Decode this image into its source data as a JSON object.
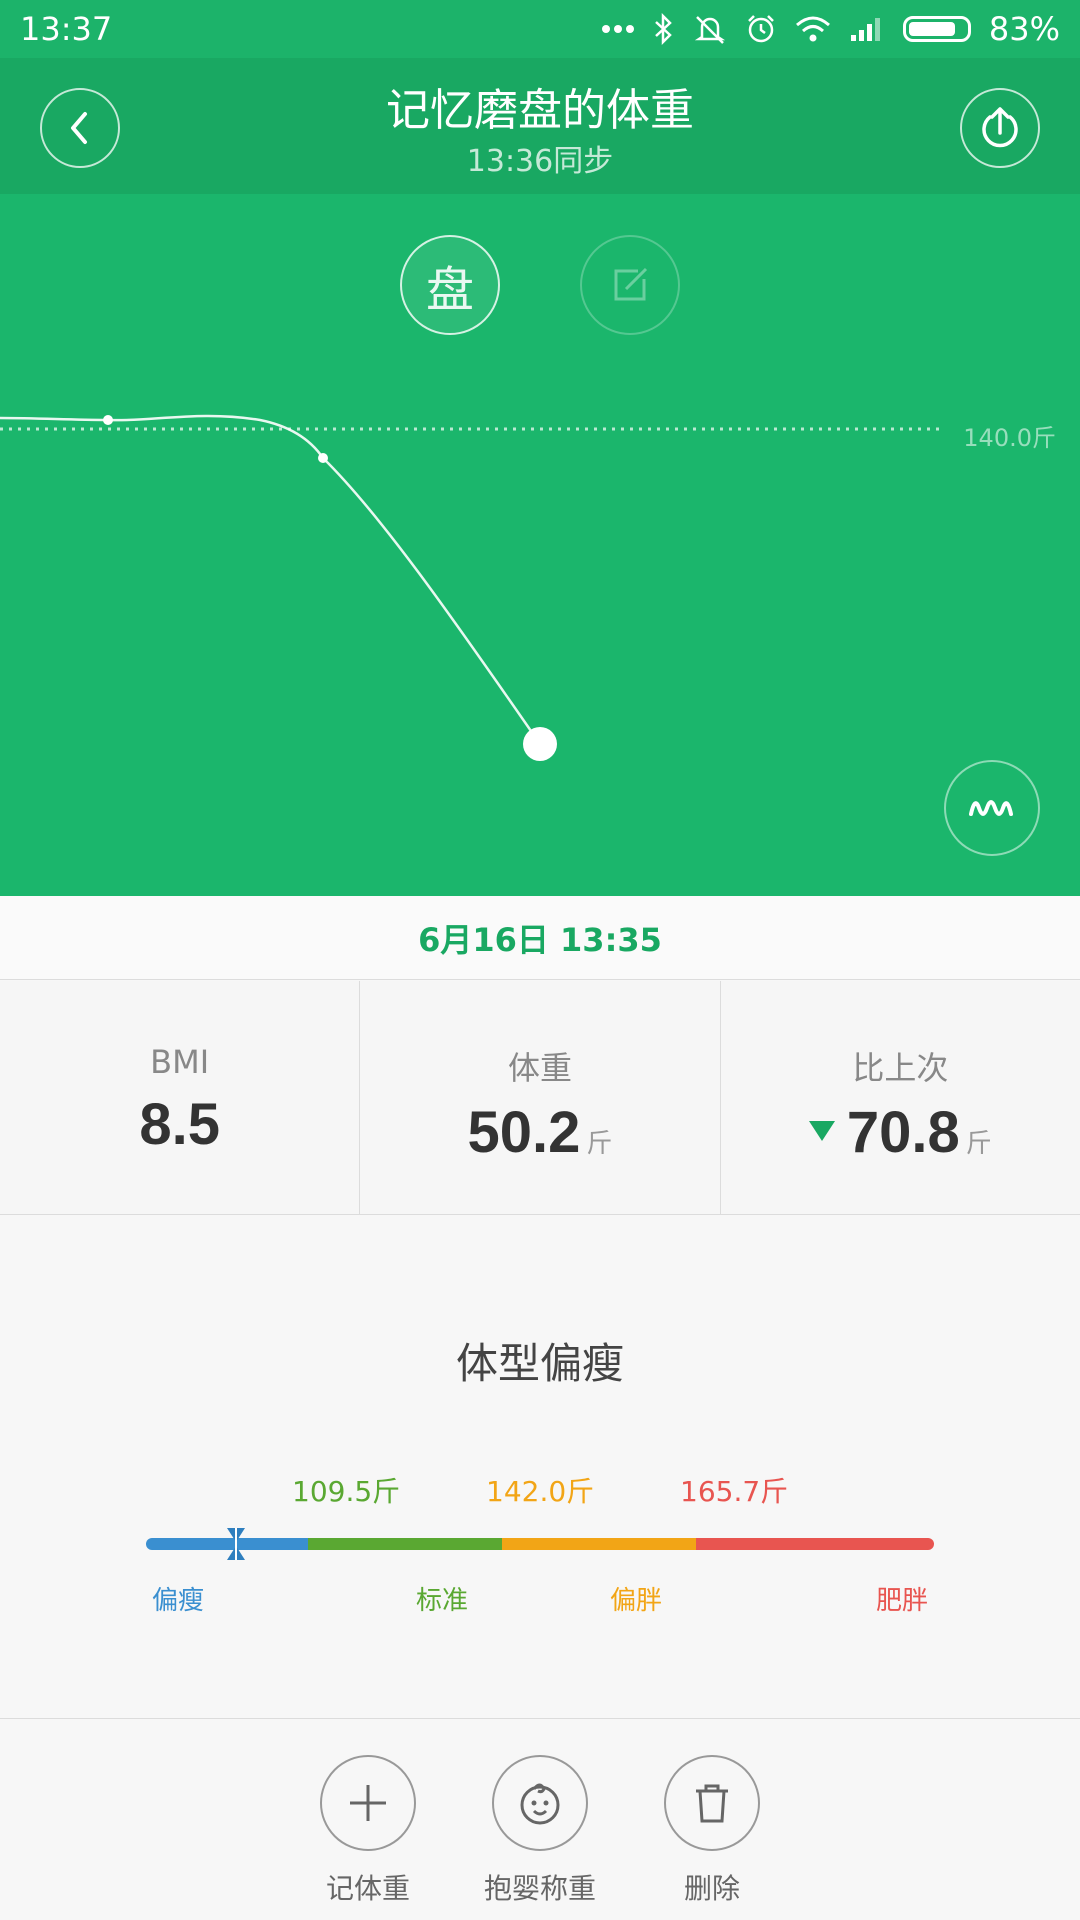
{
  "status": {
    "time": "13:37",
    "battery": "83%",
    "icons": [
      "more-dots-icon",
      "bluetooth-icon",
      "silent-icon",
      "alarm-icon",
      "wifi-icon",
      "signal-icon",
      "battery-icon"
    ]
  },
  "header": {
    "title": "记忆磨盘的体重",
    "subtitle": "13:36同步"
  },
  "modes": {
    "scale_label": "盘"
  },
  "chart_data": {
    "type": "line",
    "reference_line": {
      "value": 140.0,
      "label": "140.0斤"
    },
    "points": [
      {
        "label": "prev-1"
      },
      {
        "label": "prev-2"
      },
      {
        "label": "current",
        "value": 50.2
      }
    ],
    "line_color": "#ffffff"
  },
  "record": {
    "datetime": "6月16日 13:35"
  },
  "stats": {
    "bmi_label": "BMI",
    "bmi_value": "8.5",
    "weight_label": "体重",
    "weight_value": "50.2",
    "weight_unit": "斤",
    "change_label": "比上次",
    "change_value": "70.8",
    "change_unit": "斤",
    "change_direction": "down"
  },
  "body": {
    "type_label": "体型偏瘦",
    "thresholds": [
      "109.5斤",
      "142.0斤",
      "165.7斤"
    ],
    "categories": [
      "偏瘦",
      "标准",
      "偏胖",
      "肥胖"
    ],
    "colors": {
      "thin": "#3a8fd0",
      "standard": "#5aa832",
      "overweight": "#f2a516",
      "obese": "#e85550"
    }
  },
  "actions": {
    "record_weight": "记体重",
    "baby_weigh": "抱婴称重",
    "delete": "删除"
  },
  "theme": {
    "green": "#1bb66c",
    "dark_green": "#19a862"
  }
}
